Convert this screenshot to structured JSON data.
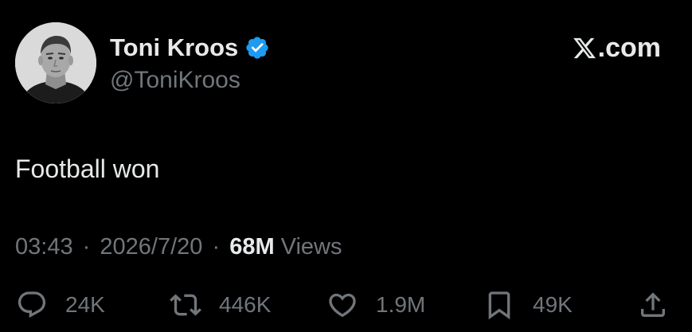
{
  "author": {
    "display_name": "Toni Kroos",
    "handle": "@ToniKroos",
    "verified": true,
    "avatar_icon": "profile-photo"
  },
  "brand": {
    "logo_icon": "x-logo-icon",
    "text": ".com"
  },
  "tweet": {
    "text": "Football won"
  },
  "meta": {
    "time": "03:43",
    "separator": "·",
    "date": "2026/7/20",
    "views_count": "68M",
    "views_label": "Views"
  },
  "actions": {
    "reply": {
      "icon": "reply-icon",
      "count": "24K"
    },
    "retweet": {
      "icon": "retweet-icon",
      "count": "446K"
    },
    "like": {
      "icon": "heart-icon",
      "count": "1.9M"
    },
    "bookmark": {
      "icon": "bookmark-icon",
      "count": "49K"
    },
    "share": {
      "icon": "share-icon"
    }
  },
  "colors": {
    "background": "#000000",
    "primary_text": "#e7e9ea",
    "secondary_text": "#71767b",
    "verified_blue": "#1d9bf0"
  }
}
